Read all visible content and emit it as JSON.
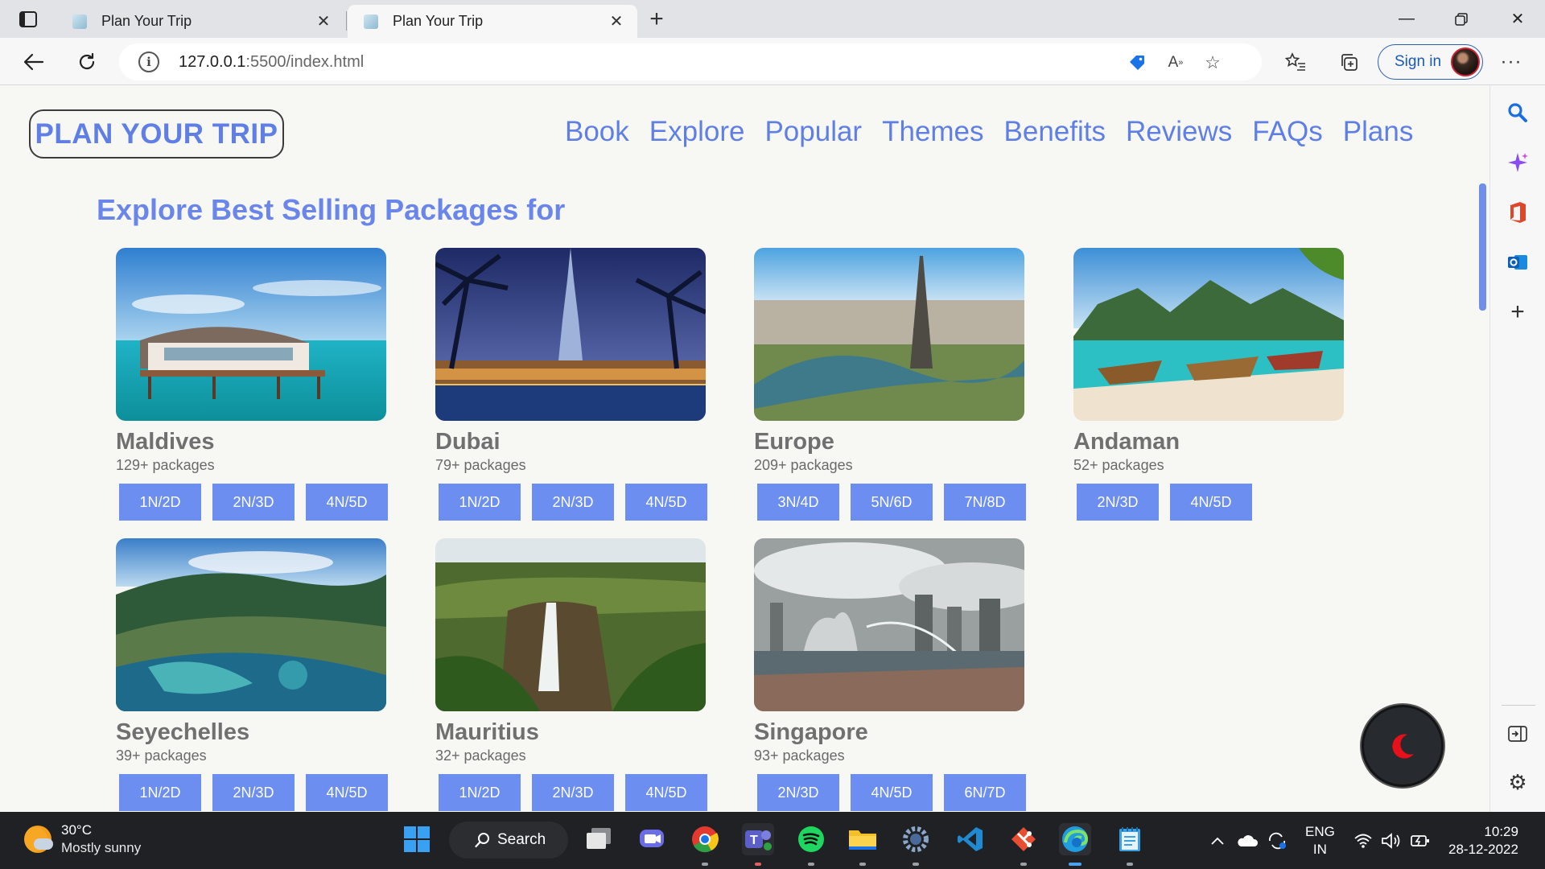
{
  "browser": {
    "tabs": [
      {
        "title": "Plan Your Trip",
        "active": false
      },
      {
        "title": "Plan Your Trip",
        "active": true
      }
    ],
    "url_host": "127.0.0.1",
    "url_path": ":5500/index.html",
    "signin_label": "Sign in"
  },
  "site": {
    "logo": "PLAN YOUR TRIP",
    "nav": [
      "Book",
      "Explore",
      "Popular",
      "Themes",
      "Benefits",
      "Reviews",
      "FAQs",
      "Plans"
    ],
    "section_title": "Explore Best Selling Packages for"
  },
  "packages": [
    {
      "name": "Maldives",
      "count": "129+ packages",
      "plans": [
        "1N/2D",
        "2N/3D",
        "4N/5D"
      ]
    },
    {
      "name": "Dubai",
      "count": "79+ packages",
      "plans": [
        "1N/2D",
        "2N/3D",
        "4N/5D"
      ]
    },
    {
      "name": "Europe",
      "count": "209+ packages",
      "plans": [
        "3N/4D",
        "5N/6D",
        "7N/8D"
      ]
    },
    {
      "name": "Andaman",
      "count": "52+ packages",
      "plans": [
        "2N/3D",
        "4N/5D"
      ]
    },
    {
      "name": "Seyechelles",
      "count": "39+ packages",
      "plans": [
        "1N/2D",
        "2N/3D",
        "4N/5D"
      ]
    },
    {
      "name": "Mauritius",
      "count": "32+ packages",
      "plans": [
        "1N/2D",
        "2N/3D",
        "4N/5D"
      ]
    },
    {
      "name": "Singapore",
      "count": "93+ packages",
      "plans": [
        "2N/3D",
        "4N/5D",
        "6N/7D"
      ]
    }
  ],
  "taskbar": {
    "temperature": "30°C",
    "weather": "Mostly sunny",
    "search_label": "Search",
    "lang_1": "ENG",
    "lang_2": "IN",
    "time": "10:29",
    "date": "28-12-2022"
  },
  "colors": {
    "brand": "#5f7fe6",
    "button": "#6b8ef0",
    "page_bg": "#f7f8f3"
  }
}
